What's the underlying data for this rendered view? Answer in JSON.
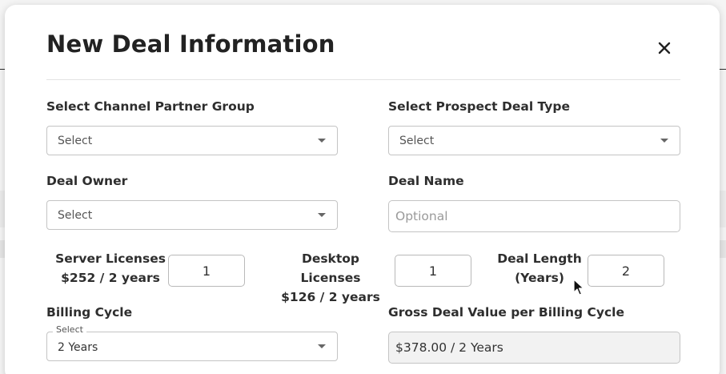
{
  "modal": {
    "title": "New Deal Information",
    "close_icon": "close-icon"
  },
  "fields": {
    "channel_partner_group": {
      "label": "Select Channel Partner Group",
      "value": "Select"
    },
    "prospect_deal_type": {
      "label": "Select Prospect Deal Type",
      "value": "Select"
    },
    "deal_owner": {
      "label": "Deal Owner",
      "value": "Select"
    },
    "deal_name": {
      "label": "Deal Name",
      "placeholder": "Optional",
      "value": ""
    },
    "server_licenses": {
      "label": "Server Licenses",
      "price": "$252 / 2 years",
      "value": "1"
    },
    "desktop_licenses": {
      "label": "Desktop Licenses",
      "price": "$126 / 2 years",
      "value": "1"
    },
    "deal_length": {
      "label_line1": "Deal Length",
      "label_line2": "(Years)",
      "value": "2"
    },
    "billing_cycle": {
      "label": "Billing Cycle",
      "floating_label": "Select",
      "value": "2 Years"
    },
    "gross_deal_value": {
      "label": "Gross Deal Value per Billing Cycle",
      "value": "$378.00 / 2 Years"
    }
  },
  "icons": {
    "dropdown": "chevron-down-icon",
    "cursor": "mouse-pointer-icon"
  }
}
